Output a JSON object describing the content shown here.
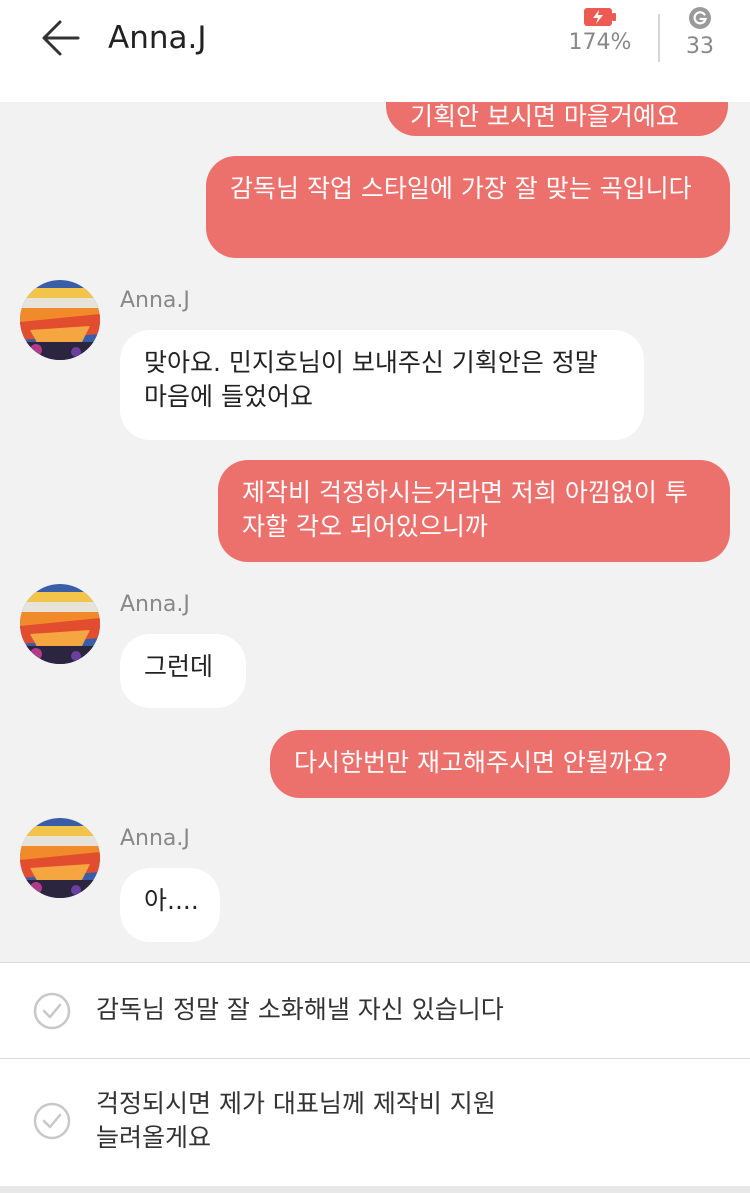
{
  "header": {
    "title": "Anna.J",
    "battery_value": "174%",
    "gem_value": "33"
  },
  "messages": [
    {
      "side": "out",
      "text": "기획안 보시면 마을거예요"
    },
    {
      "side": "out",
      "text": "감독님 작업 스타일에 가장 잘 맞는 곡입니다"
    },
    {
      "side": "in",
      "sender": "Anna.J",
      "text": "맞아요.  민지호님이 보내주신 기획안은 정말 마음에 들었어요"
    },
    {
      "side": "out",
      "text": "제작비 걱정하시는거라면 저희 아낌없이 투자할 각오 되어있으니까"
    },
    {
      "side": "in",
      "sender": "Anna.J",
      "text": "그런데"
    },
    {
      "side": "out",
      "text": "다시한번만 재고해주시면 안될까요?"
    },
    {
      "side": "in",
      "sender": "Anna.J",
      "text": "아...."
    }
  ],
  "options": [
    {
      "text": "감독님 정말 잘 소화해낼 자신 있습니다"
    },
    {
      "text": "걱정되시면 제가 대표님께 제작비 지원 늘려올게요"
    }
  ],
  "colors": {
    "accent": "#ec706b",
    "background": "#f2f2f2",
    "bubble_in": "#ffffff"
  },
  "icons": {
    "back": "arrow-left-icon",
    "battery": "battery-charging-icon",
    "gem": "g-coin-icon",
    "check": "check-circle-icon"
  }
}
